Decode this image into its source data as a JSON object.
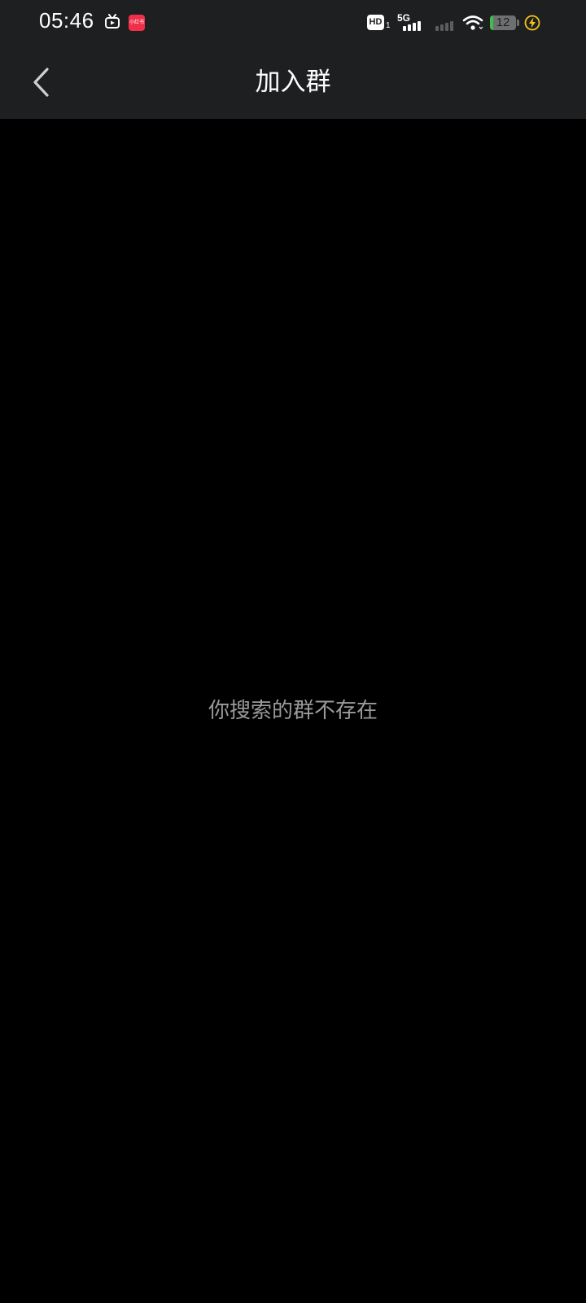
{
  "status_bar": {
    "time": "05:46",
    "app_icon_red_label": "小红书",
    "hd_label": "HD",
    "hd_sub": "1",
    "network_type": "5G",
    "battery_level": "12",
    "battery_fraction": 0.12,
    "icons": [
      "tv-app-icon",
      "red-app-icon",
      "signal-icon",
      "wifi-icon",
      "battery-icon",
      "charging-icon"
    ]
  },
  "nav": {
    "title": "加入群",
    "back_icon": "chevron-left-icon"
  },
  "main": {
    "empty_message": "你搜索的群不存在"
  },
  "colors": {
    "header_bg": "#1e1f21",
    "page_bg": "#000000",
    "message_text": "#9a9a9c",
    "charging_accent": "#f5c518"
  }
}
